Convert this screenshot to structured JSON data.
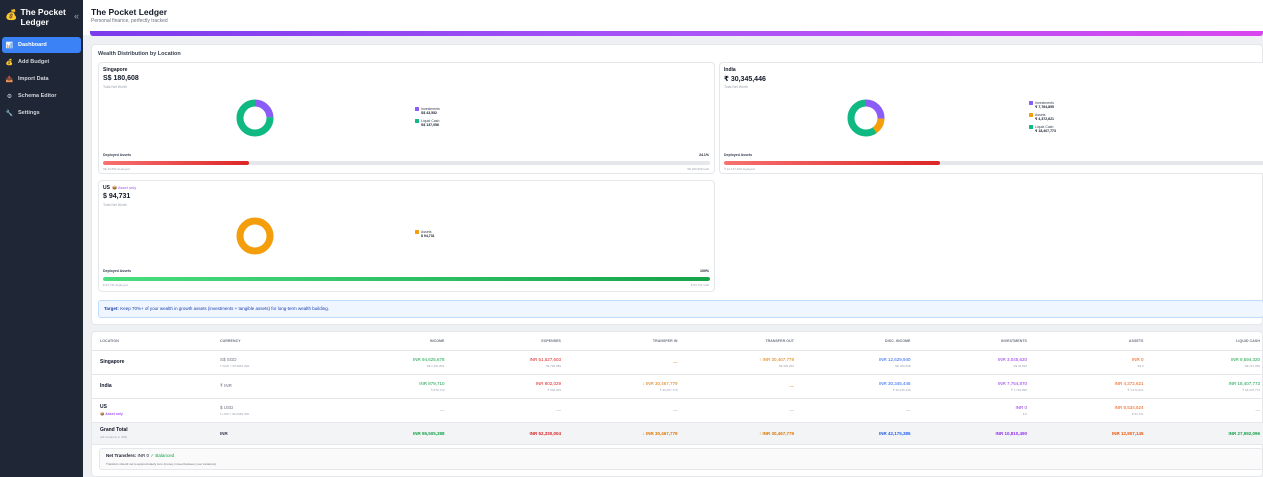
{
  "app": {
    "brand_icon": "money-bag-icon",
    "brand_name": "The Pocket Ledger",
    "collapse_glyph": "«"
  },
  "sidebar": {
    "items": [
      {
        "label": "Dashboard",
        "icon": "chart-icon",
        "glyph": "📊",
        "active": true
      },
      {
        "label": "Add Budget",
        "icon": "money-bag-icon",
        "glyph": "💰"
      },
      {
        "label": "Import Data",
        "icon": "inbox-tray-icon",
        "glyph": "📥"
      },
      {
        "label": "Schema Editor",
        "icon": "gear-icon",
        "glyph": "⚙"
      },
      {
        "label": "Settings",
        "icon": "wrench-icon",
        "glyph": "🔧"
      }
    ]
  },
  "header": {
    "title": "The Pocket Ledger",
    "subtitle": "Personal finance, perfectly tracked"
  },
  "wealth": {
    "title": "Wealth Distribution by Location",
    "cards": [
      {
        "name": "Singapore",
        "flag": "",
        "total": "S$ 180,608",
        "caption": "Total Net Worth",
        "segments": [
          {
            "label": "Investments",
            "value": "S$ 43,552",
            "share": 0.241,
            "color": "#8b5cf6"
          },
          {
            "label": "Liquid Cash",
            "value": "S$ 137,056",
            "share": 0.759,
            "color": "#10b981"
          }
        ],
        "deploy_label": "Deployed Assets",
        "deploy_pct_text": "24.1%",
        "deploy_fraction": 0.241,
        "deploy_left": "S$ 43,552 deployed",
        "deploy_right": "S$ 180,608 total",
        "bar_color": "red"
      },
      {
        "name": "India",
        "flag": "",
        "total": "₹ 30,345,446",
        "caption": "Total Net Worth",
        "segments": [
          {
            "label": "Investments",
            "value": "₹ 7,764,895",
            "share": 0.256,
            "color": "#8b5cf6"
          },
          {
            "label": "Assets",
            "value": "₹ 4,372,621",
            "share": 0.144,
            "color": "#f59e0b"
          },
          {
            "label": "Liquid Cash",
            "value": "₹ 18,407,773",
            "share": 0.6,
            "color": "#10b981"
          }
        ],
        "deploy_label": "Deployed Assets",
        "deploy_pct_text": "",
        "deploy_fraction": 0.4,
        "deploy_left": "₹ 12,137,516 deployed",
        "deploy_right": "",
        "bar_color": "red"
      },
      {
        "name": "US",
        "flag": "📦 Asset only",
        "total": "$ 94,731",
        "caption": "Total Net Worth",
        "segments": [
          {
            "label": "Assets",
            "value": "$ 94,731",
            "share": 1.0,
            "color": "#f59e0b"
          }
        ],
        "deploy_label": "Deployed Assets",
        "deploy_pct_text": "100%",
        "deploy_fraction": 1.0,
        "deploy_left": "$ 94,731 deployed",
        "deploy_right": "$ 94,731 total",
        "bar_color": "green"
      }
    ],
    "target_prefix": "Target:",
    "target_text": "Keep 70%+ of your wealth in growth assets (investments + tangible assets) for long-term wealth building."
  },
  "table": {
    "headers": [
      "LOCATION",
      "CURRENCY",
      "INCOME",
      "EXPENSES",
      "TRANSFER IN",
      "TRANSFER OUT",
      "DISC. INCOME",
      "INVESTMENTS",
      "ASSETS",
      "LIQUID CASH"
    ],
    "rows": [
      {
        "location": "Singapore",
        "location_sub": "",
        "currency": "S$ SGD",
        "currency_sub": "1 SGD = 69.9961 INR",
        "cells": [
          {
            "main": "INR 94,625,678",
            "sub": "S$ 1,351,861",
            "color": "c-green"
          },
          {
            "main": "INR 51,527,603",
            "sub": "S$ 736,089",
            "color": "c-red"
          },
          {
            "main": "—",
            "sub": "",
            "color": "c-amber"
          },
          {
            "main": "↑ INR 30,467,779",
            "sub": "S$ 435,265",
            "color": "c-amber"
          },
          {
            "main": "INR 12,629,940",
            "sub": "S$ 180,608",
            "color": "c-blue"
          },
          {
            "main": "INR 3,045,620",
            "sub": "S$ 43,552",
            "color": "c-purple"
          },
          {
            "main": "INR 0",
            "sub": "S$ 0",
            "color": "c-orange"
          },
          {
            "main": "INR 9,594,320",
            "sub": "S$ 137,056",
            "color": "c-green"
          }
        ]
      },
      {
        "location": "India",
        "location_sub": "",
        "currency": "₹ INR",
        "currency_sub": "",
        "cells": [
          {
            "main": "INR 879,710",
            "sub": "₹ 879,710",
            "color": "c-green"
          },
          {
            "main": "INR 802,029",
            "sub": "₹ 802,029",
            "color": "c-red"
          },
          {
            "main": "↓ INR 30,467,779",
            "sub": "₹ 30,467,779",
            "color": "c-amber"
          },
          {
            "main": "—",
            "sub": "",
            "color": "c-amber"
          },
          {
            "main": "INR 30,345,446",
            "sub": "₹ 30,345,446",
            "color": "c-blue"
          },
          {
            "main": "INR 7,764,870",
            "sub": "₹ 7,764,895",
            "color": "c-purple"
          },
          {
            "main": "INR 4,372,621",
            "sub": "₹ 4,372,621",
            "color": "c-orange"
          },
          {
            "main": "INR 18,407,773",
            "sub": "₹ 18,407,773",
            "color": "c-green"
          }
        ]
      },
      {
        "location": "US",
        "location_sub": "📦 Asset only",
        "currency": "$ USD",
        "currency_sub": "1 USD = 89.0983 INR",
        "cells": [
          {
            "main": "—",
            "sub": "",
            "color": "dash"
          },
          {
            "main": "—",
            "sub": "",
            "color": "dash"
          },
          {
            "main": "—",
            "sub": "",
            "color": "dash"
          },
          {
            "main": "—",
            "sub": "",
            "color": "dash"
          },
          {
            "main": "—",
            "sub": "",
            "color": "dash"
          },
          {
            "main": "INR 0",
            "sub": "$ 0",
            "color": "c-purple"
          },
          {
            "main": "INR 8,534,524",
            "sub": "$ 94,731",
            "color": "c-orange"
          },
          {
            "main": "—",
            "sub": "",
            "color": "dash"
          }
        ]
      }
    ],
    "total": {
      "location": "Grand Total",
      "location_sub": "(All locations in INR)",
      "currency": "INR",
      "cells": [
        {
          "main": "INR 95,505,388",
          "color": "c-green"
        },
        {
          "main": "INR 52,330,004",
          "color": "c-red"
        },
        {
          "main": "↓ INR 30,467,779",
          "color": "c-amber"
        },
        {
          "main": "↑ INR 30,467,779",
          "color": "c-amber"
        },
        {
          "main": "INR 42,175,385",
          "color": "c-blue"
        },
        {
          "main": "INR 10,810,490",
          "color": "c-purple"
        },
        {
          "main": "INR 12,907,145",
          "color": "c-orange"
        },
        {
          "main": "INR 27,992,096",
          "color": "c-green"
        }
      ]
    },
    "net_transfers_label": "Net Transfers:",
    "net_transfers_value": "INR 0",
    "net_transfers_status": "✓ Balanced",
    "net_transfers_note": "Transfers should net to approximately zero (money moved between your locations)"
  }
}
